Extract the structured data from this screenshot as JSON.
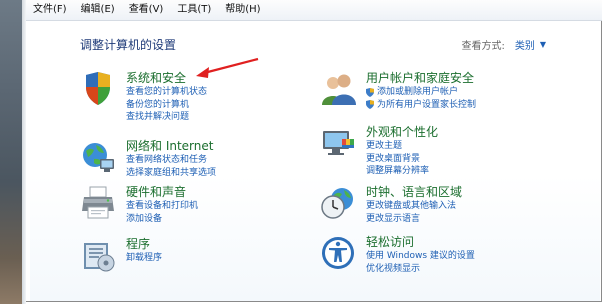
{
  "menu": [
    "文件(F)",
    "编辑(E)",
    "查看(V)",
    "工具(T)",
    "帮助(H)"
  ],
  "page_title": "调整计算机的设置",
  "view_by": {
    "label": "查看方式:",
    "value": "类别"
  },
  "categories_left": [
    {
      "title": "系统和安全",
      "icon": "shield-computer-icon",
      "links": [
        "查看您的计算机状态",
        "备份您的计算机",
        "查找并解决问题"
      ]
    },
    {
      "title": "网络和 Internet",
      "icon": "network-globe-icon",
      "links": [
        "查看网络状态和任务",
        "选择家庭组和共享选项"
      ]
    },
    {
      "title": "硬件和声音",
      "icon": "printer-icon",
      "links": [
        "查看设备和打印机",
        "添加设备"
      ]
    },
    {
      "title": "程序",
      "icon": "programs-icon",
      "links": [
        "卸载程序"
      ]
    }
  ],
  "categories_right": [
    {
      "title": "用户帐户和家庭安全",
      "icon": "users-icon",
      "links": [
        "添加或删除用户帐户",
        "为所有用户设置家长控制"
      ]
    },
    {
      "title": "外观和个性化",
      "icon": "appearance-icon",
      "links": [
        "更改主题",
        "更改桌面背景",
        "调整屏幕分辨率"
      ]
    },
    {
      "title": "时钟、语言和区域",
      "icon": "clock-globe-icon",
      "links": [
        "更改键盘或其他输入法",
        "更改显示语言"
      ]
    },
    {
      "title": "轻松访问",
      "icon": "ease-of-access-icon",
      "links": [
        "使用 Windows 建议的设置",
        "优化视频显示"
      ]
    }
  ],
  "colors": {
    "category_title": "#1b6e2e",
    "link": "#1e5fb4",
    "heading": "#1e3a78",
    "annotation_arrow": "#e02020"
  }
}
